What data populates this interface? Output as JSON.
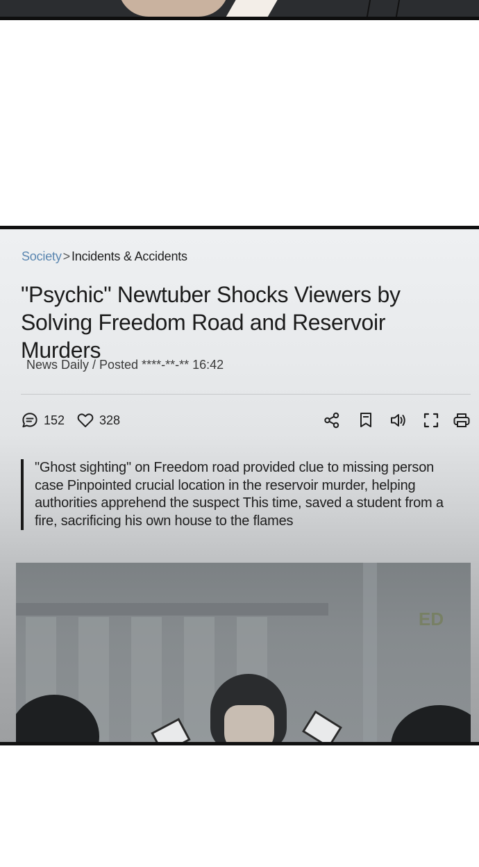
{
  "breadcrumb": {
    "section": "Society",
    "separator": ">",
    "current": "Incidents & Accidents"
  },
  "article": {
    "title": "\"Psychic\" Newtuber Shocks Viewers by Solving Freedom Road and Reservoir Murders",
    "byline": "News Daily / Posted ****-**-** 16:42",
    "summary": "\"Ghost sighting\" on Freedom road provided clue to missing person case Pinpointed crucial location in the reservoir murder, helping authorities apprehend the suspect This time, saved a student from a fire, sacrificing his own house to the flames"
  },
  "stats": {
    "comments": "152",
    "likes": "328"
  },
  "toolbar": {
    "icons": [
      "share-icon",
      "bookmark-icon",
      "audio-icon",
      "fullscreen-icon",
      "print-icon"
    ]
  },
  "scene": {
    "sign_text": "ED"
  },
  "colors": {
    "link": "#5a86b0",
    "panel_border": "#111111",
    "text": "#1e1e1e"
  }
}
